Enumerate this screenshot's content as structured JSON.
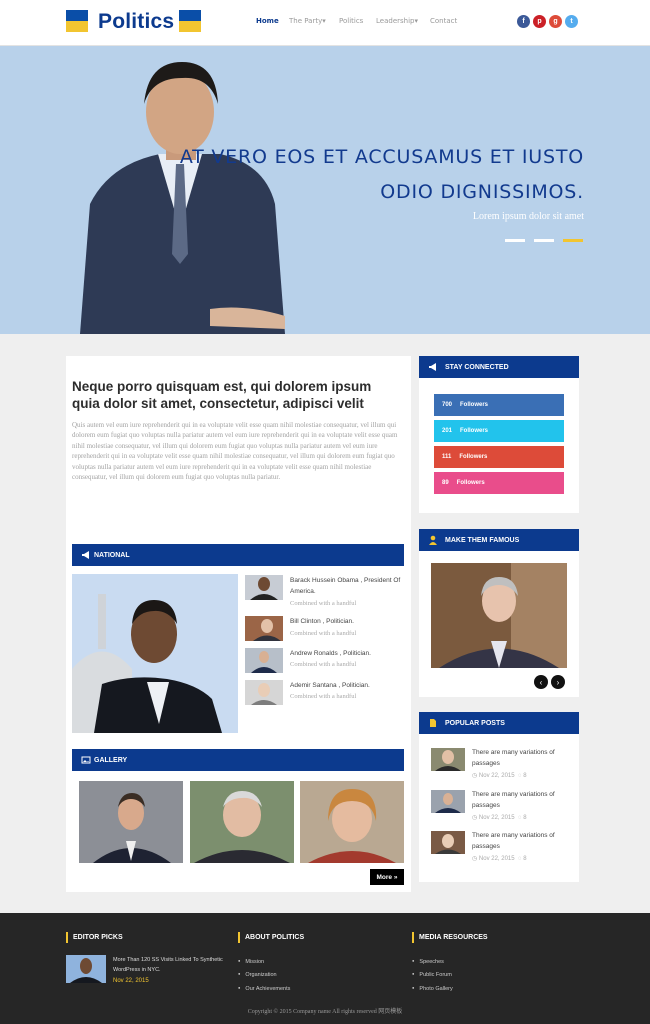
{
  "header": {
    "logo_text": "Politics",
    "nav": [
      "Home",
      "The Party",
      "Politics",
      "Leadership",
      "Contact"
    ],
    "social_icons": [
      "facebook-icon",
      "pinterest-icon",
      "google-plus-icon",
      "twitter-icon"
    ]
  },
  "hero": {
    "title_line1": "AT VERO EOS ET ACCUSAMUS ET IUSTO",
    "title_line2": "ODIO DIGNISSIMOS.",
    "subtitle": "Lorem ipsum dolor sit amet",
    "slides": 3,
    "active_slide": 3
  },
  "main": {
    "title": "Neque porro quisquam est, qui dolorem ipsum quia dolor sit amet, consectetur, adipisci velit",
    "paragraph": "Quis autem vel eum iure reprehenderit qui in ea voluptate velit esse quam nihil molestiae consequatur, vel illum qui dolorem eum fugiat quo voluptas nulla pariatur autem vel eum iure reprehenderit qui in ea voluptate velit esse quam nihil molestiae consequatur, vel illum qui dolorem eum fugiat quo voluptas nulla pariatur autem vel eum iure reprehenderit qui in ea voluptate velit esse quam nihil molestiae consequatur, vel illum qui dolorem eum fugiat quo voluptas nulla pariatur autem vel eum iure reprehenderit qui in ea voluptate velit esse quam nihil molestiae consequatur, vel illum qui dolorem eum fugiat quo voluptas nulla pariatur.",
    "national_label": "NATIONAL",
    "national_items": [
      {
        "title": "Barack Hussein Obama , President Of America.",
        "sub": "Combined with a handful"
      },
      {
        "title": "Bill Clinton , Politician.",
        "sub": "Combined with a handful"
      },
      {
        "title": "Andrew Ronalds , Politician.",
        "sub": "Combined with a handful"
      },
      {
        "title": "Ademir Santana , Politician.",
        "sub": "Combined with a handful"
      }
    ],
    "gallery_label": "GALLERY",
    "more_label": "More »"
  },
  "sidebar": {
    "stay_connected": "STAY CONNECTED",
    "followers": [
      {
        "count": "700",
        "label": "Followers",
        "color": "#3a6fb5"
      },
      {
        "count": "201",
        "label": "Followers",
        "color": "#22c3ec"
      },
      {
        "count": "111",
        "label": "Followers",
        "color": "#dd4b39"
      },
      {
        "count": "89",
        "label": "Followers",
        "color": "#e94d8b"
      }
    ],
    "make_them_famous": "MAKE THEM FAMOUS",
    "popular_posts": "POPULAR POSTS",
    "posts": [
      {
        "title": "There are many variations of passages",
        "date": "Nov 22, 2015",
        "comments": "8"
      },
      {
        "title": "There are many variations of passages",
        "date": "Nov 22, 2015",
        "comments": "8"
      },
      {
        "title": "There are many variations of passages",
        "date": "Nov 22, 2015",
        "comments": "8"
      }
    ]
  },
  "footer": {
    "editor_picks": "EDITOR PICKS",
    "editor_item": "More Than 120 SS Visits Linked To Synthetic WordPress in NYC.",
    "editor_date": "Nov 22, 2015",
    "about_politics": "ABOUT POLITICS",
    "about_items": [
      "Mission",
      "Organization",
      "Our Achievements"
    ],
    "media_resources": "MEDIA RESOURCES",
    "media_items": [
      "Speeches",
      "Public Forum",
      "Photo Gallery"
    ],
    "copyright": "Copyright © 2015 Company name All rights reserved 网页模板"
  },
  "colors": {
    "brand": "#0c3a8e",
    "accent": "#f2c530"
  }
}
